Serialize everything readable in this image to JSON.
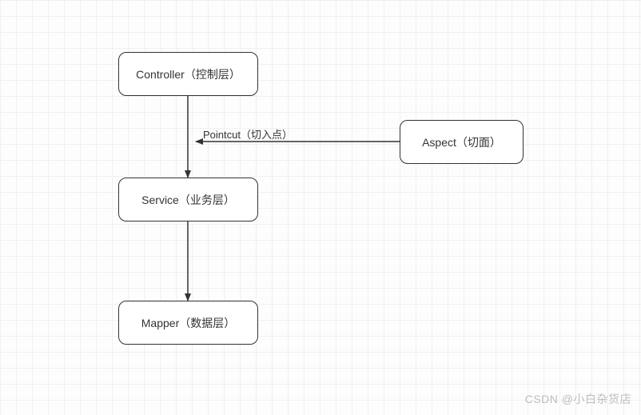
{
  "nodes": {
    "controller": {
      "label": "Controller（控制层）"
    },
    "service": {
      "label": "Service（业务层）"
    },
    "mapper": {
      "label": "Mapper（数据层）"
    },
    "aspect": {
      "label": "Aspect（切面）"
    }
  },
  "edges": {
    "pointcut": {
      "label": "Pointcut（切入点）"
    }
  },
  "watermark": "CSDN @小白杂货店"
}
